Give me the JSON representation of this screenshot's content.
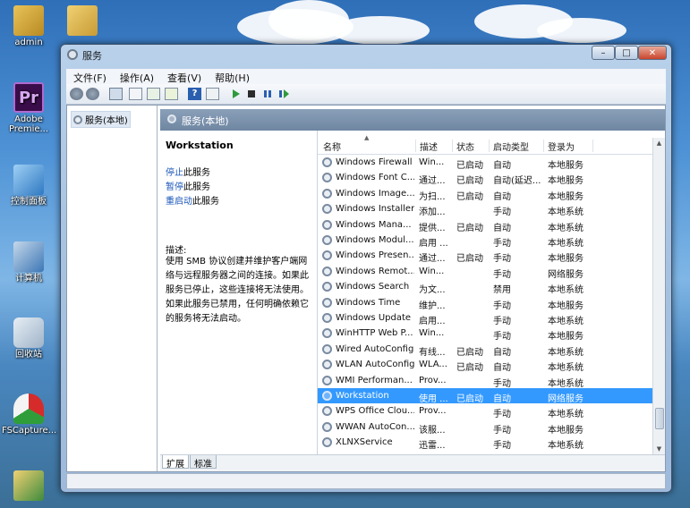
{
  "desktop": {
    "icons": [
      {
        "label": "admin",
        "kind": "user-folder"
      },
      {
        "label": "",
        "kind": "folder"
      },
      {
        "label": "Adobe Premie...",
        "kind": "premiere",
        "glyph": "Pr"
      },
      {
        "label": "控制面板",
        "kind": "control-panel"
      },
      {
        "label": "计算机",
        "kind": "computer"
      },
      {
        "label": "回收站",
        "kind": "recycle-bin"
      },
      {
        "label": "FSCapture...",
        "kind": "fscapture"
      }
    ]
  },
  "window": {
    "title": "服务",
    "controls": {
      "minimize": "–",
      "maximize": "□",
      "close": "✕"
    },
    "menu": [
      "文件(F)",
      "操作(A)",
      "查看(V)",
      "帮助(H)"
    ],
    "tree": {
      "root": "服务(本地)"
    },
    "header": "服务(本地)",
    "details": {
      "service_name": "Workstation",
      "stop": {
        "link": "停止",
        "rest": "此服务"
      },
      "pause": {
        "link": "暂停",
        "rest": "此服务"
      },
      "restart": {
        "link": "重启动",
        "rest": "此服务"
      },
      "desc_label": "描述:",
      "desc_text": "使用 SMB 协议创建并维护客户端网络与远程服务器之间的连接。如果此服务已停止，这些连接将无法使用。如果此服务已禁用，任何明确依赖它的服务将无法启动。"
    },
    "columns": {
      "name": "名称",
      "desc": "描述",
      "status": "状态",
      "startup": "启动类型",
      "logon": "登录为"
    },
    "services": [
      {
        "name": "Windows Firewall",
        "desc": "Win...",
        "status": "已启动",
        "startup": "自动",
        "logon": "本地服务"
      },
      {
        "name": "Windows Font C...",
        "desc": "通过...",
        "status": "已启动",
        "startup": "自动(延迟...",
        "logon": "本地服务"
      },
      {
        "name": "Windows Image...",
        "desc": "为扫...",
        "status": "已启动",
        "startup": "自动",
        "logon": "本地服务"
      },
      {
        "name": "Windows Installer",
        "desc": "添加...",
        "status": "",
        "startup": "手动",
        "logon": "本地系统"
      },
      {
        "name": "Windows Mana...",
        "desc": "提供...",
        "status": "已启动",
        "startup": "自动",
        "logon": "本地系统"
      },
      {
        "name": "Windows Modul...",
        "desc": "启用 ...",
        "status": "",
        "startup": "手动",
        "logon": "本地系统"
      },
      {
        "name": "Windows Presen...",
        "desc": "通过...",
        "status": "已启动",
        "startup": "手动",
        "logon": "本地服务"
      },
      {
        "name": "Windows Remot...",
        "desc": "Win...",
        "status": "",
        "startup": "手动",
        "logon": "网络服务"
      },
      {
        "name": "Windows Search",
        "desc": "为文...",
        "status": "",
        "startup": "禁用",
        "logon": "本地系统"
      },
      {
        "name": "Windows Time",
        "desc": "维护...",
        "status": "",
        "startup": "手动",
        "logon": "本地服务"
      },
      {
        "name": "Windows Update",
        "desc": "启用...",
        "status": "",
        "startup": "手动",
        "logon": "本地系统"
      },
      {
        "name": "WinHTTP Web P...",
        "desc": "Win...",
        "status": "",
        "startup": "手动",
        "logon": "本地服务"
      },
      {
        "name": "Wired AutoConfig",
        "desc": "有线...",
        "status": "已启动",
        "startup": "自动",
        "logon": "本地系统"
      },
      {
        "name": "WLAN AutoConfig",
        "desc": "WLA...",
        "status": "已启动",
        "startup": "自动",
        "logon": "本地系统"
      },
      {
        "name": "WMI Performan...",
        "desc": "Prov...",
        "status": "",
        "startup": "手动",
        "logon": "本地系统"
      },
      {
        "name": "Workstation",
        "desc": "使用 ...",
        "status": "已启动",
        "startup": "自动",
        "logon": "网络服务",
        "selected": true
      },
      {
        "name": "WPS Office Clou...",
        "desc": "Prov...",
        "status": "",
        "startup": "手动",
        "logon": "本地系统"
      },
      {
        "name": "WWAN AutoCon...",
        "desc": "该服...",
        "status": "",
        "startup": "手动",
        "logon": "本地服务"
      },
      {
        "name": "XLNXService",
        "desc": "迅雷...",
        "status": "",
        "startup": "手动",
        "logon": "本地系统"
      }
    ],
    "tabs": [
      "扩展",
      "标准"
    ]
  }
}
